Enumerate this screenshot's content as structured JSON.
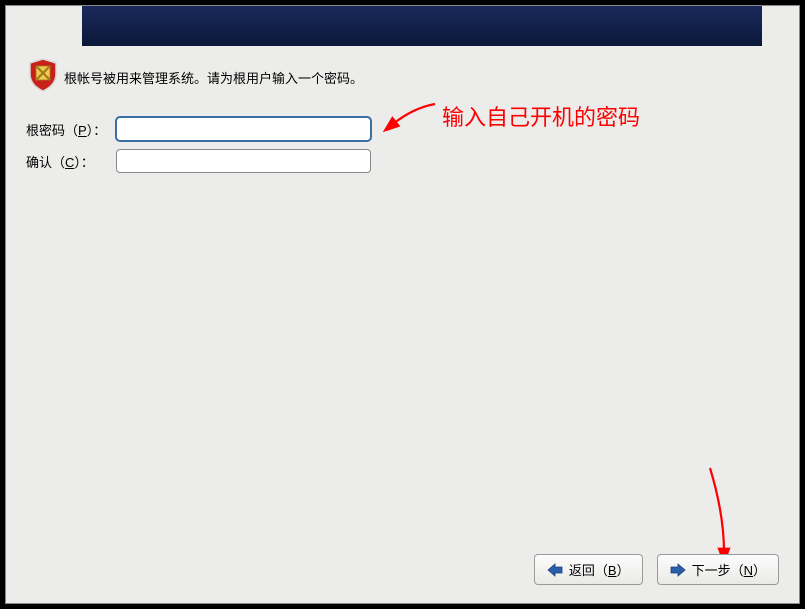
{
  "description": "根帐号被用来管理系统。请为根用户输入一个密码。",
  "fields": {
    "password": {
      "label_prefix": "根密码（",
      "label_key": "P",
      "label_suffix": "）：",
      "value": ""
    },
    "confirm": {
      "label_prefix": "确认（",
      "label_key": "C",
      "label_suffix": "）：",
      "value": ""
    }
  },
  "annotation": {
    "text": "输入自己开机的密码"
  },
  "buttons": {
    "back": {
      "label_prefix": "返回（",
      "label_key": "B",
      "label_suffix": "）"
    },
    "next": {
      "label_prefix": "下一步（",
      "label_key": "N",
      "label_suffix": "）"
    }
  },
  "colors": {
    "annotation": "#ff0000",
    "banner_dark": "#0c1838",
    "accent_blue": "#2b5fab"
  }
}
